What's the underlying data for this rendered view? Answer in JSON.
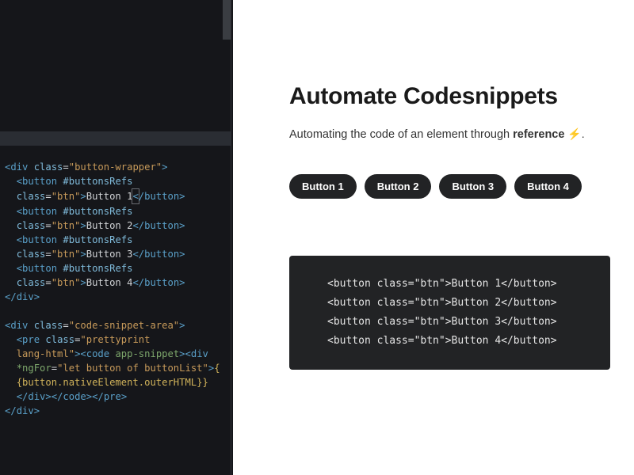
{
  "editor": {
    "code_html": "<span class='ta'>&lt;</span><span class='t'>div</span> <span class='at'>class</span><span class='pn'>=</span><span class='st'>\"button-wrapper\"</span><span class='ta'>&gt;</span>\n  <span class='ta'>&lt;</span><span class='t'>button</span> <span class='kw'>#buttonsRefs</span>\n  <span class='at'>class</span><span class='pn'>=</span><span class='st'>\"btn\"</span><span class='ta'>&gt;</span><span class='tx'>Button 1</span><span class='cursor-box'><span class='tc'>&lt;</span></span><span class='tc'>/button&gt;</span>\n  <span class='ta'>&lt;</span><span class='t'>button</span> <span class='kw'>#buttonsRefs</span>\n  <span class='at'>class</span><span class='pn'>=</span><span class='st'>\"btn\"</span><span class='ta'>&gt;</span><span class='tx'>Button 2</span><span class='tc'>&lt;/button&gt;</span>\n  <span class='ta'>&lt;</span><span class='t'>button</span> <span class='kw'>#buttonsRefs</span>\n  <span class='at'>class</span><span class='pn'>=</span><span class='st'>\"btn\"</span><span class='ta'>&gt;</span><span class='tx'>Button 3</span><span class='tc'>&lt;/button&gt;</span>\n  <span class='ta'>&lt;</span><span class='t'>button</span> <span class='kw'>#buttonsRefs</span>\n  <span class='at'>class</span><span class='pn'>=</span><span class='st'>\"btn\"</span><span class='ta'>&gt;</span><span class='tx'>Button 4</span><span class='tc'>&lt;/button&gt;</span>\n<span class='tc'>&lt;/</span><span class='t'>div</span><span class='tc'>&gt;</span>\n\n<span class='ta'>&lt;</span><span class='t'>div</span> <span class='at'>class</span><span class='pn'>=</span><span class='st'>\"code-snippet-area\"</span><span class='ta'>&gt;</span>\n  <span class='ta'>&lt;</span><span class='t'>pre</span> <span class='at'>class</span><span class='pn'>=</span><span class='st'>\"prettyprint</span>\n  <span class='st'>lang-html\"</span><span class='ta'>&gt;</span><span class='ta'>&lt;</span><span class='t'>code</span> <span class='gr'>app-snippet</span><span class='ta'>&gt;</span><span class='ta'>&lt;</span><span class='t'>div</span>\n  <span class='gr'>*ngFor</span><span class='pn'>=</span><span class='st'>\"let button of buttonList\"</span><span class='ta'>&gt;</span><span class='yl'>{</span>\n  <span class='yl'>{button.nativeElement.outerHTML}}</span>\n  <span class='tc'>&lt;/</span><span class='t'>div</span><span class='tc'>&gt;</span><span class='tc'>&lt;/</span><span class='t'>code</span><span class='tc'>&gt;</span><span class='tc'>&lt;/</span><span class='t'>pre</span><span class='tc'>&gt;</span>\n<span class='tc'>&lt;/</span><span class='t'>div</span><span class='tc'>&gt;</span>"
  },
  "preview": {
    "title": "Automate Codesnippets",
    "subtitle_pre": "Automating the code of an element through ",
    "subtitle_bold": "reference",
    "subtitle_post": " ⚡.",
    "buttons": [
      {
        "label": "Button 1"
      },
      {
        "label": "Button 2"
      },
      {
        "label": "Button 3"
      },
      {
        "label": "Button 4"
      }
    ],
    "snippet_lines": [
      "<button class=\"btn\">Button 1</button>",
      "<button class=\"btn\">Button 2</button>",
      "<button class=\"btn\">Button 3</button>",
      "<button class=\"btn\">Button 4</button>"
    ]
  }
}
